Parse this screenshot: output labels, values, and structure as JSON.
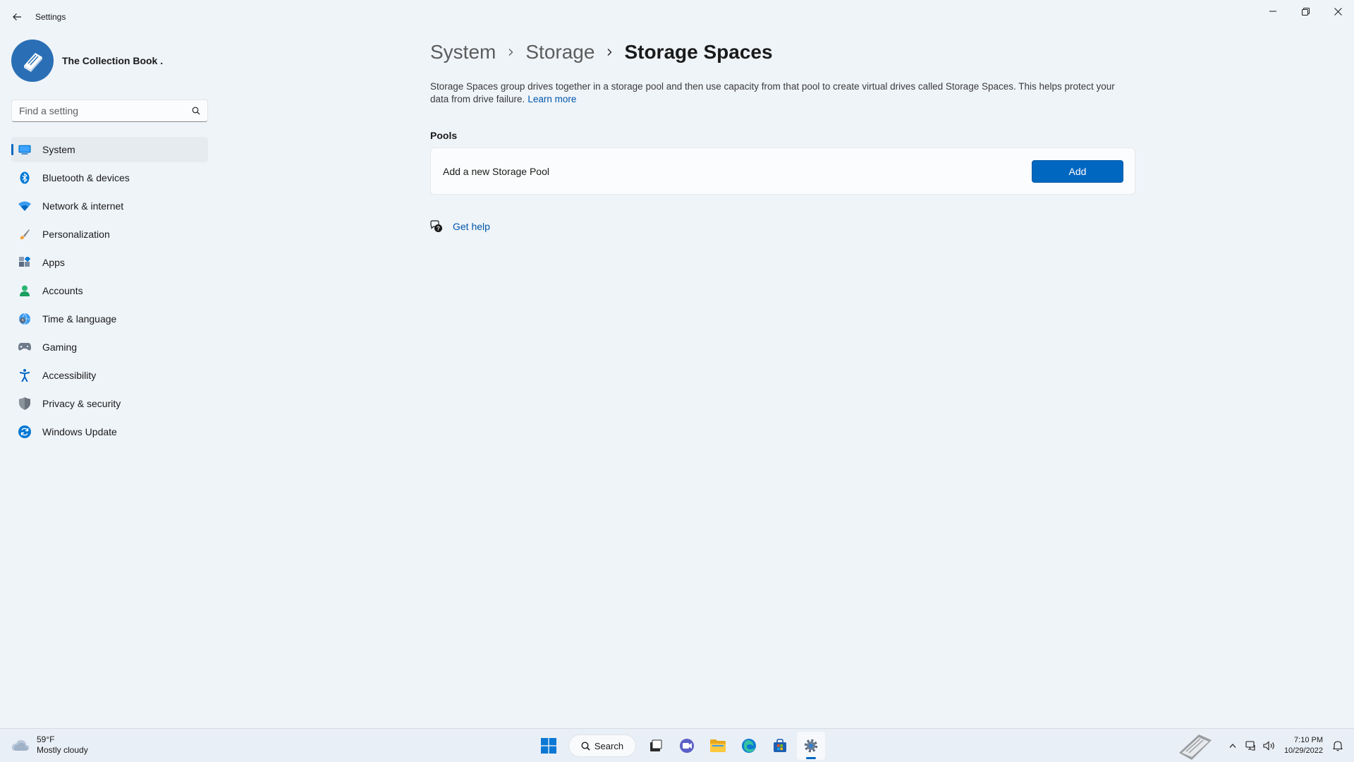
{
  "window": {
    "app_title": "Settings",
    "profile_name": "The Collection Book ."
  },
  "search": {
    "placeholder": "Find a setting"
  },
  "sidebar": {
    "items": [
      {
        "label": "System",
        "icon": "system-display-icon",
        "active": true
      },
      {
        "label": "Bluetooth & devices",
        "icon": "bluetooth-icon"
      },
      {
        "label": "Network & internet",
        "icon": "wifi-icon"
      },
      {
        "label": "Personalization",
        "icon": "paintbrush-icon"
      },
      {
        "label": "Apps",
        "icon": "apps-icon"
      },
      {
        "label": "Accounts",
        "icon": "person-icon"
      },
      {
        "label": "Time & language",
        "icon": "globe-clock-icon"
      },
      {
        "label": "Gaming",
        "icon": "gamepad-icon"
      },
      {
        "label": "Accessibility",
        "icon": "accessibility-icon"
      },
      {
        "label": "Privacy & security",
        "icon": "shield-icon"
      },
      {
        "label": "Windows Update",
        "icon": "update-icon"
      }
    ]
  },
  "breadcrumb": {
    "items": [
      "System",
      "Storage",
      "Storage Spaces"
    ]
  },
  "main": {
    "description": "Storage Spaces group drives together in a storage pool and then use capacity from that pool to create virtual drives called Storage Spaces. This helps protect your data from drive failure.",
    "learn_more": "Learn more",
    "section_title": "Pools",
    "card_label": "Add a new Storage Pool",
    "add_button": "Add",
    "get_help": "Get help"
  },
  "taskbar": {
    "weather_temp": "59°F",
    "weather_desc": "Mostly cloudy",
    "search_label": "Search",
    "time": "7:10 PM",
    "date": "10/29/2022",
    "watermark": "TheCollectionBook"
  },
  "colors": {
    "accent": "#0067c0",
    "link": "#0055a8",
    "background": "#eff4f9"
  }
}
